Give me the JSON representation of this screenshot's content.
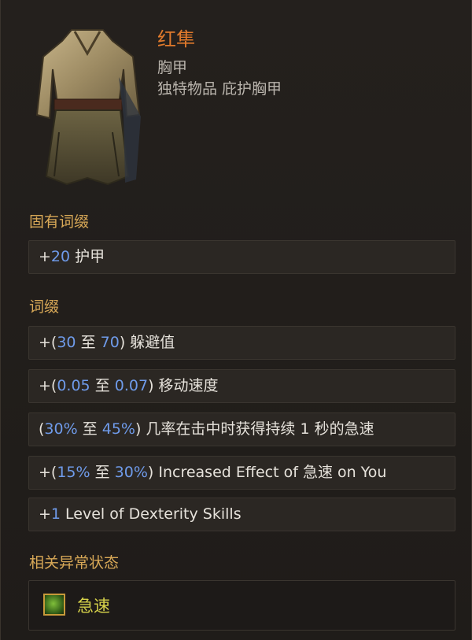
{
  "item": {
    "name": "红隼",
    "type": "胸甲",
    "rarity_line": "独特物品 庇护胸甲"
  },
  "implicit": {
    "title": "固有词缀",
    "mods": [
      {
        "prefix": "+",
        "num": "20",
        "suffix": " 护甲"
      }
    ]
  },
  "affixes": {
    "title": "词缀",
    "mods": [
      {
        "p1": "+(",
        "n1": "30",
        "mid": " 至 ",
        "n2": "70",
        "p2": ") 躲避值"
      },
      {
        "p1": "+(",
        "n1": "0.05",
        "mid": " 至 ",
        "n2": "0.07",
        "p2": ") 移动速度"
      },
      {
        "p1": "(",
        "n1": "30%",
        "mid": " 至 ",
        "n2": "45%",
        "p2": ") 几率在击中时获得持续 1 秒的急速"
      },
      {
        "p1": "+(",
        "n1": "15%",
        "mid": " 至 ",
        "n2": "30%",
        "p2": ") Increased Effect of 急速 on You"
      },
      {
        "p1": "+",
        "n1": "1",
        "p2": " Level of Dexterity Skills"
      }
    ]
  },
  "ailments": {
    "title": "相关异常状态",
    "items": [
      {
        "label": "急速",
        "icon": "haste-icon"
      }
    ]
  },
  "colors": {
    "name": "#e07a2c",
    "section": "#d8a857",
    "value": "#6f9bea",
    "status": "#d6d24a"
  }
}
